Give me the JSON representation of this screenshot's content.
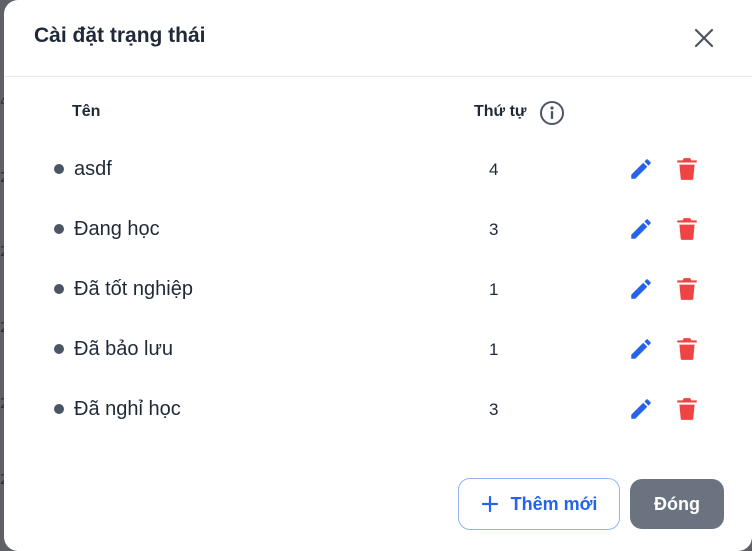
{
  "backdrop": {
    "glyphs": [
      "4",
      "2",
      "2",
      "2",
      "2",
      "2"
    ]
  },
  "modal": {
    "title": "Cài đặt trạng thái",
    "columns": {
      "name": "Tên",
      "order": "Thứ tự"
    },
    "rows": [
      {
        "name": "asdf",
        "order": "4"
      },
      {
        "name": "Đang học",
        "order": "3"
      },
      {
        "name": "Đã tốt nghiệp",
        "order": "1"
      },
      {
        "name": "Đã bảo lưu",
        "order": "1"
      },
      {
        "name": "Đã nghỉ học",
        "order": "3"
      }
    ],
    "buttons": {
      "add": "Thêm mới",
      "close": "Đóng"
    }
  },
  "colors": {
    "accent": "#2563eb",
    "danger": "#ef4444",
    "close_button": "#6b7280",
    "bullet": "#4b5563"
  },
  "icons": {
    "close": "close-icon",
    "info": "info-icon",
    "edit": "pencil-icon",
    "delete": "trash-icon",
    "add": "plus-icon"
  }
}
